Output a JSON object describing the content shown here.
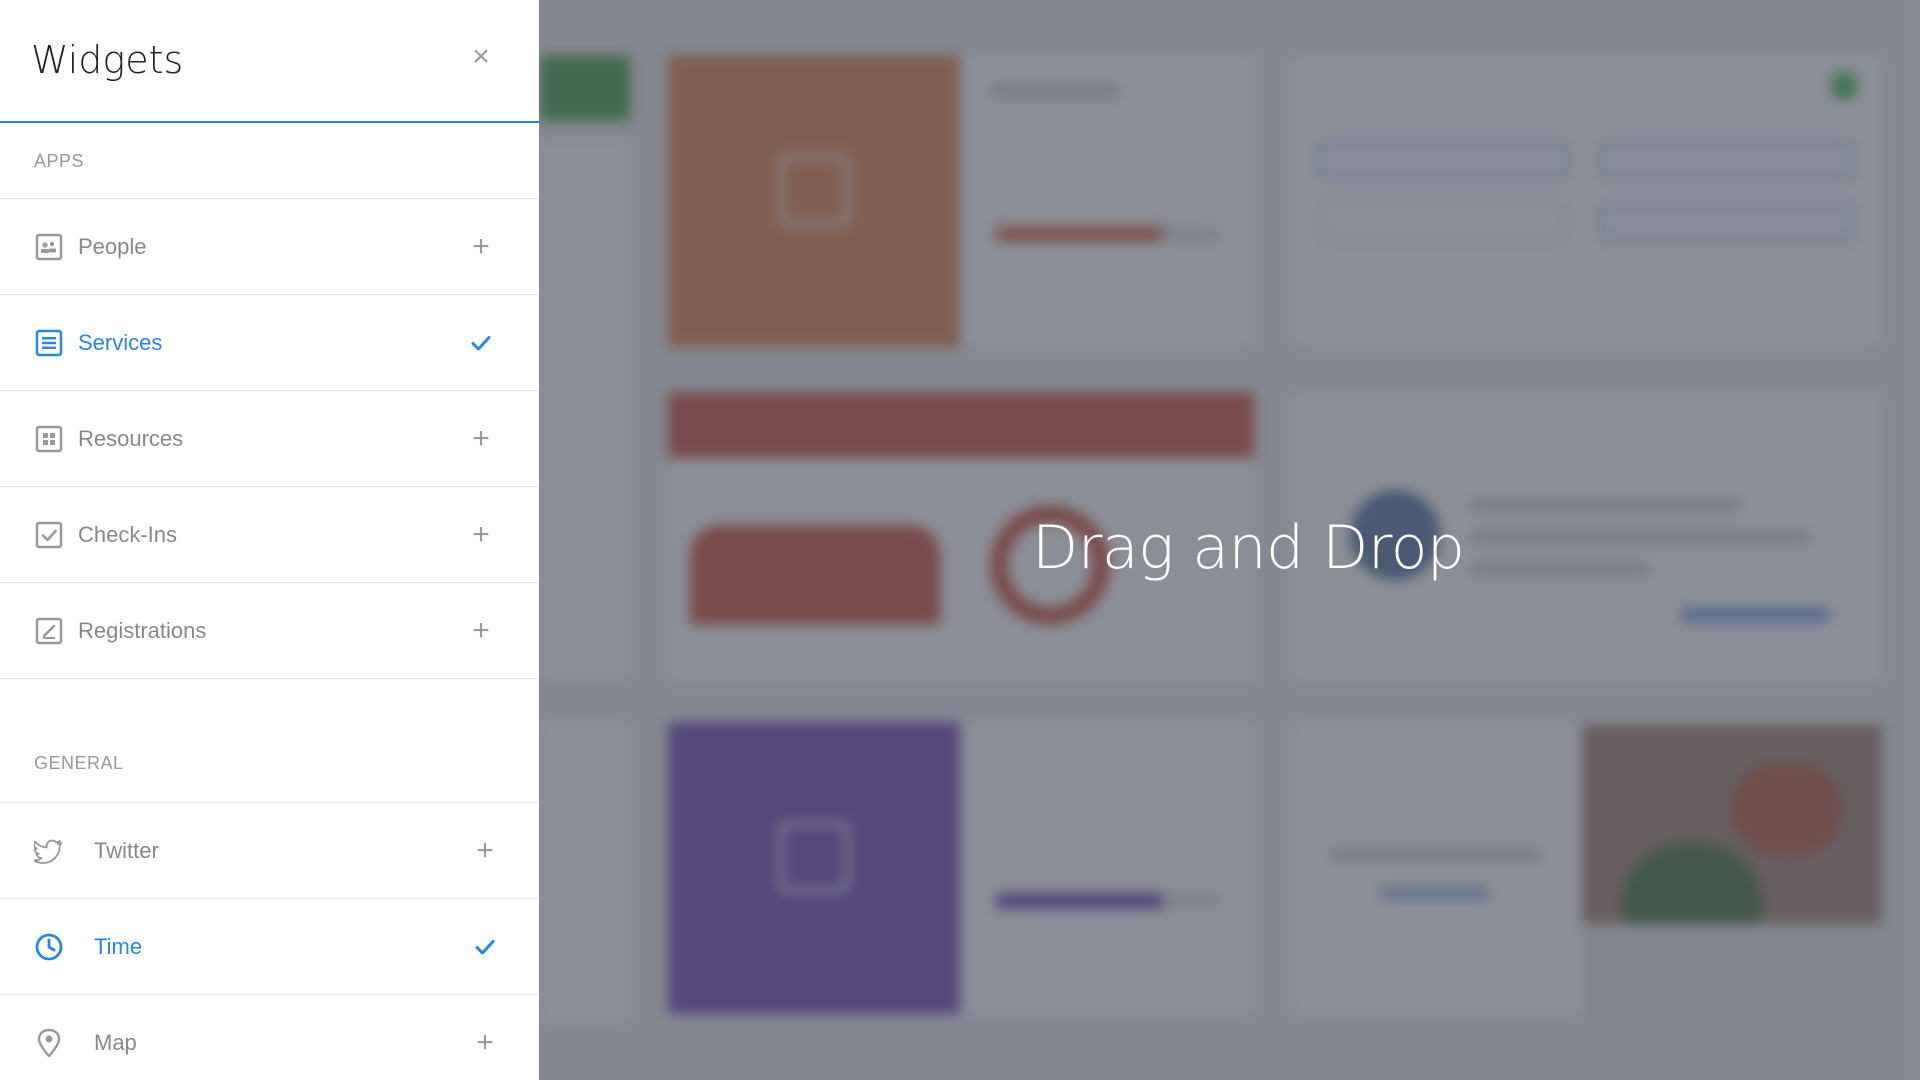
{
  "panel": {
    "title": "Widgets",
    "close_icon": "×",
    "sections": {
      "apps_label": "APPS",
      "general_label": "GENERAL"
    },
    "apps": [
      {
        "label": "People",
        "icon": "people-icon",
        "state": "add"
      },
      {
        "label": "Services",
        "icon": "services-icon",
        "state": "added"
      },
      {
        "label": "Resources",
        "icon": "resources-icon",
        "state": "add"
      },
      {
        "label": "Check-Ins",
        "icon": "check-ins-icon",
        "state": "add"
      },
      {
        "label": "Registrations",
        "icon": "registrations-icon",
        "state": "add"
      }
    ],
    "general": [
      {
        "label": "Twitter",
        "icon": "twitter-icon",
        "state": "add"
      },
      {
        "label": "Time",
        "icon": "clock-icon",
        "state": "added"
      },
      {
        "label": "Map",
        "icon": "map-pin-icon",
        "state": "add"
      }
    ],
    "add_symbol": "+",
    "added_symbol": "✓"
  },
  "overlay": {
    "drag_text": "Drag and Drop"
  },
  "colors": {
    "accent": "#2a86e0",
    "muted": "#888888",
    "services_tile": "#d87a3e",
    "resources_tile": "#c94a33",
    "checkins_tile": "#6a3fb0",
    "green_tile": "#3a9a3a",
    "teal_tile": "#2a8a8a"
  }
}
